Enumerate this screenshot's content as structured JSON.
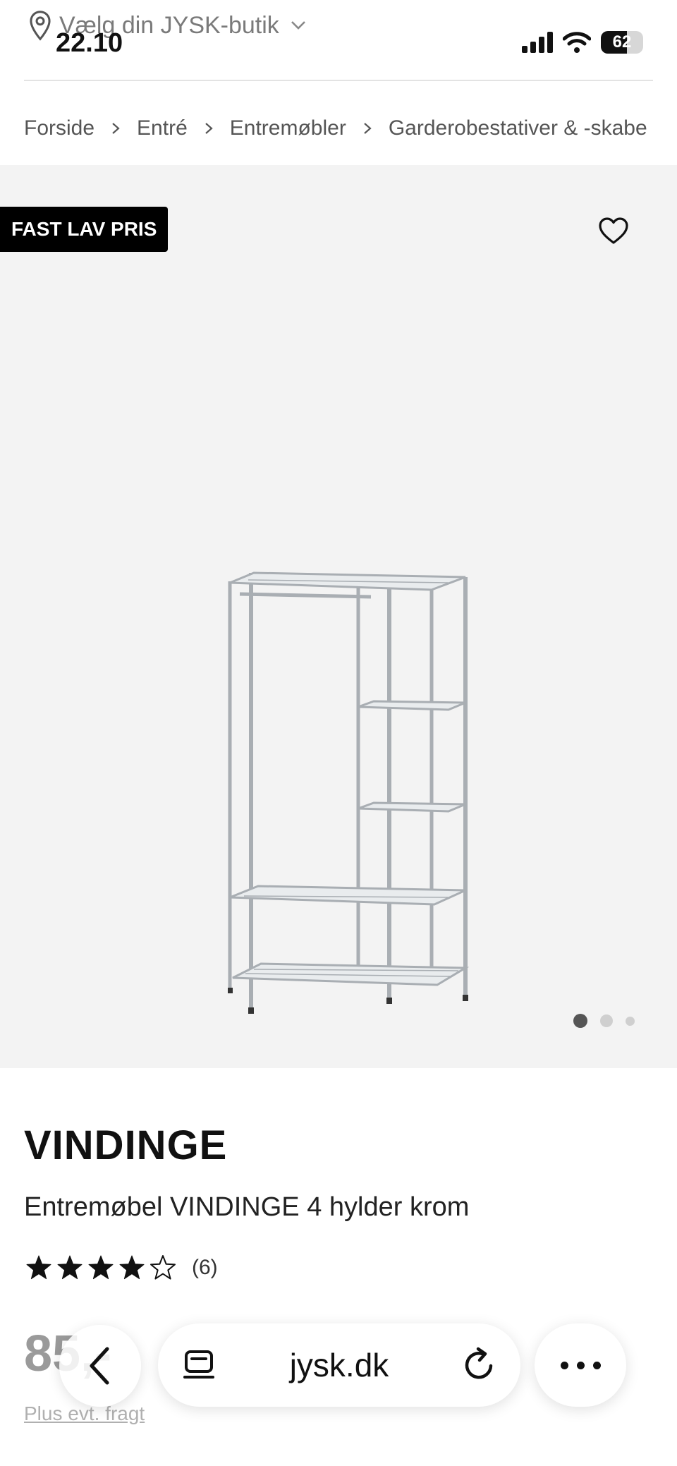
{
  "status_bar": {
    "time": "22.10",
    "battery": "62",
    "battery_level": 0.62
  },
  "store_selector": {
    "label": "Vælg din JYSK-butik"
  },
  "breadcrumb": {
    "items": [
      {
        "label": "Forside"
      },
      {
        "label": "Entré"
      },
      {
        "label": "Entremøbler"
      },
      {
        "label": "Garderobestativer & -skabe"
      }
    ]
  },
  "gallery": {
    "badge": "FAST LAV PRIS",
    "image_count": 3,
    "active_index": 0
  },
  "product": {
    "brand": "VINDINGE",
    "name": "Entremøbel VINDINGE 4 hylder krom",
    "rating": 4,
    "rating_max": 5,
    "review_count": "(6)",
    "price": "85,-",
    "freight_link": "Plus evt. fragt"
  },
  "browser": {
    "url": "jysk.dk"
  },
  "colors": {
    "badge_bg": "#000000",
    "gallery_bg": "#f3f3f3",
    "muted_text": "#9a9a9a"
  },
  "icons": {
    "location": "location-pin-icon",
    "chevron": "chevron-down-icon",
    "favorite": "heart-icon",
    "back": "chevron-left-icon",
    "tabs": "tabs-icon",
    "reload": "reload-icon",
    "more": "more-icon"
  }
}
